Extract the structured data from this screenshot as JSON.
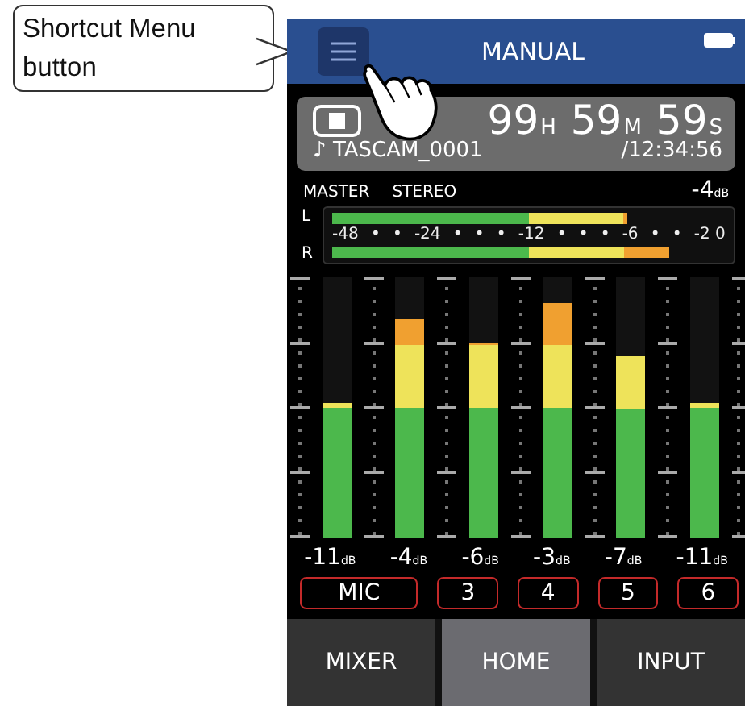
{
  "callout": {
    "text": "Shortcut Menu button"
  },
  "header": {
    "title": "MANUAL"
  },
  "time_panel": {
    "hours": "99",
    "hours_unit": "H",
    "minutes": "59",
    "minutes_unit": "M",
    "seconds": "59",
    "seconds_unit": "S",
    "file_icon": "♪",
    "file_name": "TASCAM_0001",
    "total": "/12:34:56"
  },
  "master": {
    "label": "MASTER",
    "mode": "STEREO",
    "reading": "-4",
    "reading_unit": "dB",
    "meters": [
      {
        "name": "L",
        "level": 0.75
      },
      {
        "name": "R",
        "level": 0.855
      }
    ],
    "scale": [
      "-48",
      "•",
      "•",
      "-24",
      "•",
      "•",
      "•",
      "-12",
      "•",
      "•",
      "•",
      "-6",
      "•",
      "•",
      "-2 0"
    ]
  },
  "channels": [
    {
      "level": 0.52,
      "reading": "-11",
      "unit": "dB"
    },
    {
      "level": 0.84,
      "reading": "-4",
      "unit": "dB"
    },
    {
      "level": 0.745,
      "reading": "-6",
      "unit": "dB"
    },
    {
      "level": 0.9,
      "reading": "-3",
      "unit": "dB"
    },
    {
      "level": 0.7,
      "reading": "-7",
      "unit": "dB"
    },
    {
      "level": 0.52,
      "reading": "-11",
      "unit": "dB"
    }
  ],
  "inputs": [
    {
      "label": "MIC"
    },
    {
      "label": "3"
    },
    {
      "label": "4"
    },
    {
      "label": "5"
    },
    {
      "label": "6"
    }
  ],
  "tabs": [
    {
      "label": "MIXER",
      "selected": false
    },
    {
      "label": "HOME",
      "selected": true
    },
    {
      "label": "INPUT",
      "selected": false
    }
  ]
}
